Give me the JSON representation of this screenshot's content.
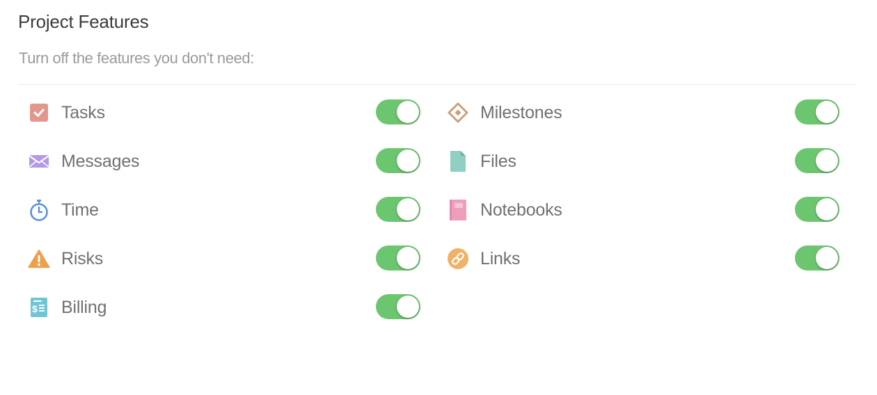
{
  "header": {
    "title": "Project Features",
    "subtitle": "Turn off the features you don't need:"
  },
  "features": {
    "tasks": {
      "label": "Tasks",
      "icon": "task-check-icon",
      "color": "#e2978d",
      "enabled": true
    },
    "messages": {
      "label": "Messages",
      "icon": "envelope-icon",
      "color": "#b49ae6",
      "enabled": true
    },
    "time": {
      "label": "Time",
      "icon": "stopwatch-icon",
      "color": "#5b8fdc",
      "enabled": true
    },
    "risks": {
      "label": "Risks",
      "icon": "warning-icon",
      "color": "#eba04e",
      "enabled": true
    },
    "billing": {
      "label": "Billing",
      "icon": "invoice-icon",
      "color": "#6fc4d6",
      "enabled": true
    },
    "milestones": {
      "label": "Milestones",
      "icon": "diamond-icon",
      "color": "#c9a07c",
      "enabled": true
    },
    "files": {
      "label": "Files",
      "icon": "file-icon",
      "color": "#8fcfc4",
      "enabled": true
    },
    "notebooks": {
      "label": "Notebooks",
      "icon": "notebook-icon",
      "color": "#ef9dbc",
      "enabled": true
    },
    "links": {
      "label": "Links",
      "icon": "link-icon",
      "color": "#efb266",
      "enabled": true
    }
  },
  "toggle_colors": {
    "on": "#6cc66f",
    "knob": "#ffffff"
  }
}
